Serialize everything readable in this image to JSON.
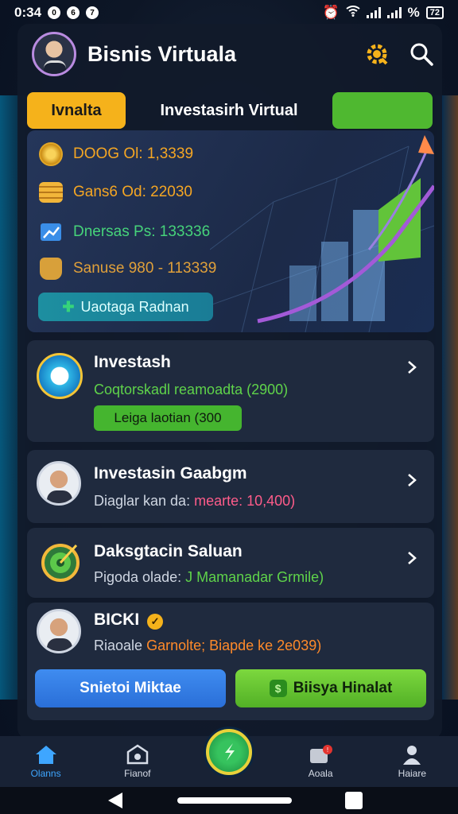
{
  "status_bar": {
    "time": "0:34",
    "notif_icons": [
      "0",
      "6",
      "7"
    ],
    "battery": "72"
  },
  "header": {
    "title": "Bisnis  Virtuala"
  },
  "tabs": [
    {
      "label": "Ivnalta"
    },
    {
      "label": "Investasirh Virtual"
    },
    {
      "label": ""
    }
  ],
  "hero": {
    "stats": [
      {
        "label": "DOOG Ol: 1,3339",
        "color": "#f5a623",
        "icon": "coin-icon"
      },
      {
        "label": "Gans6 Od: 22030",
        "color": "#f5a623",
        "icon": "coin-stack-icon"
      },
      {
        "label": "Dnersas Ps: 133336",
        "color": "#46d37a",
        "icon": "growth-chart-icon"
      },
      {
        "label": "Sanuse 980 - 113339",
        "color": "#e0a03a",
        "icon": "money-bag-icon"
      }
    ],
    "button_label": "Uaotaga Radnan"
  },
  "items": [
    {
      "title": "Investash",
      "subtitle": "Coqtorskadl reamoadta (2900)",
      "subtitle_color": "#5fd34a",
      "pill": "Leiga laotian (300"
    },
    {
      "title": "Investasin Gaabgm",
      "subtitle_prefix": "Diaglar kan da:",
      "subtitle_highlight": "mearte: 10,400)",
      "highlight_color": "#ff5c8a"
    },
    {
      "title": "Daksgtacin Saluan",
      "subtitle_prefix": "Pigoda olade:",
      "subtitle_highlight": "J Mamanadar Grmile)",
      "highlight_color": "#5fd34a"
    },
    {
      "title": "BICKI",
      "subtitle_prefix": "Riaoale",
      "subtitle_highlight": "Garnolte; Biapde ke 2e039)",
      "highlight_color": "#ff8a2a"
    }
  ],
  "actions": {
    "primary": "Snietoi Miktae",
    "secondary": "Biisya Hinalat"
  },
  "bottom_nav": [
    {
      "label": "Olanns",
      "icon": "home-icon",
      "active": true
    },
    {
      "label": "Fianof",
      "icon": "bank-icon",
      "active": false
    },
    {
      "label": "",
      "icon": "exchange-icon",
      "active": false
    },
    {
      "label": "Aoala",
      "icon": "notification-icon",
      "active": false
    },
    {
      "label": "Haiare",
      "icon": "profile-icon",
      "active": false
    }
  ],
  "colors": {
    "accent_orange": "#f5b21b",
    "accent_green": "#4fb830",
    "accent_blue": "#3f8cf0",
    "card_bg": "#1f2a3e"
  }
}
